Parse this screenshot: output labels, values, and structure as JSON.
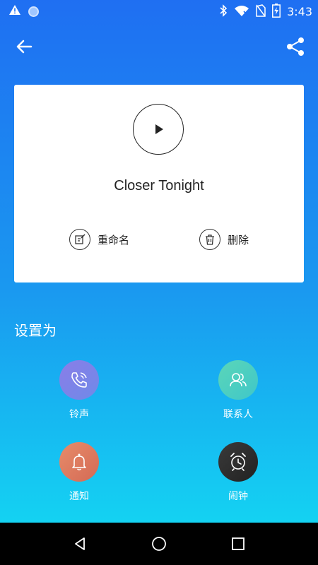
{
  "status_bar": {
    "time": "3:43",
    "icons": [
      "warning-icon",
      "circle-icon",
      "bluetooth-icon",
      "wifi-icon",
      "no-sim-icon",
      "battery-charging-icon"
    ]
  },
  "toolbar": {
    "back_icon": "arrow-left-icon",
    "share_icon": "share-icon"
  },
  "card": {
    "play_icon": "play-icon",
    "song_title": "Closer Tonight",
    "rename_label": "重命名",
    "delete_label": "删除"
  },
  "set_as": {
    "title": "设置为",
    "options": [
      {
        "label": "铃声",
        "icon": "phone-ring-icon",
        "color": "#7f7ee8"
      },
      {
        "label": "联系人",
        "icon": "contacts-icon",
        "color": "#4fd1c0"
      },
      {
        "label": "通知",
        "icon": "bell-icon",
        "color": "#e07a5e"
      },
      {
        "label": "闹钟",
        "icon": "alarm-clock-icon",
        "color": "#333333"
      }
    ]
  },
  "colors": {
    "gradient_top": "#1f6ff2",
    "gradient_bottom": "#14d2f2",
    "card_bg": "#ffffff",
    "nav_bg": "#000000"
  }
}
